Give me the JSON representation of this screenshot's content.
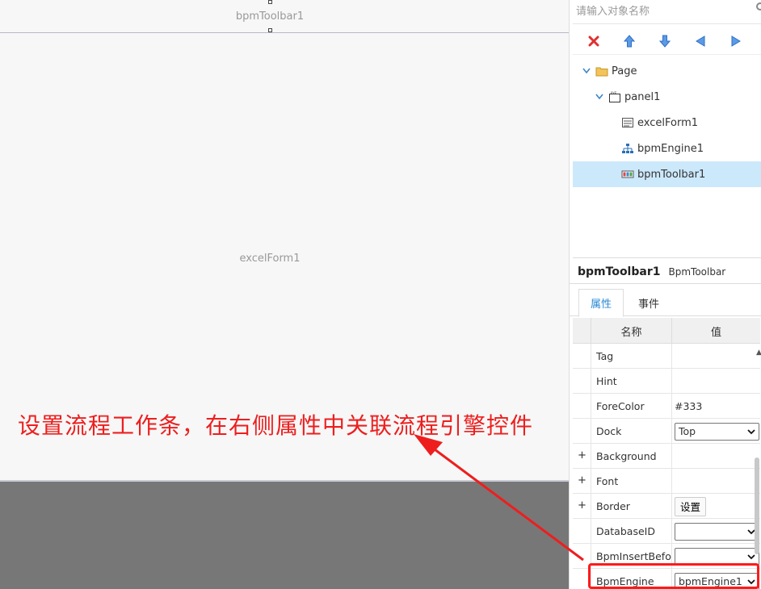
{
  "canvas": {
    "toolbar_control_name": "bpmToolbar1",
    "form_control_name": "excelForm1"
  },
  "annotation": {
    "text": "设置流程工作条，在右侧属性中关联流程引擎控件",
    "color": "#ee1e1e"
  },
  "side": {
    "search_placeholder": "请输入对象名称",
    "tree_toolbar": [
      {
        "icon": "delete-icon",
        "color": "#e03030"
      },
      {
        "icon": "arrow-up-icon",
        "color": "#3a7bd5"
      },
      {
        "icon": "arrow-down-icon",
        "color": "#3a7bd5"
      },
      {
        "icon": "arrow-left-icon",
        "color": "#3a7bd5"
      },
      {
        "icon": "arrow-right-icon",
        "color": "#3a7bd5"
      }
    ],
    "tree": [
      {
        "label": "Page",
        "icon": "folder-icon",
        "expanded": true
      },
      {
        "label": "panel1",
        "icon": "panel-icon",
        "expanded": true
      },
      {
        "label": "excelForm1",
        "icon": "form-icon"
      },
      {
        "label": "bpmEngine1",
        "icon": "engine-icon"
      },
      {
        "label": "bpmToolbar1",
        "icon": "toolbar-icon",
        "selected": true
      }
    ]
  },
  "properties": {
    "object_name": "bpmToolbar1",
    "object_type": "BpmToolbar",
    "tabs": [
      "属性",
      "事件"
    ],
    "active_tab": "属性",
    "headers": {
      "name": "名称",
      "value": "值"
    },
    "rows": [
      {
        "name": "Tag",
        "value": ""
      },
      {
        "name": "Hint",
        "value": ""
      },
      {
        "name": "ForeColor",
        "value": "#333"
      },
      {
        "name": "Dock",
        "value": "Top",
        "kind": "select"
      },
      {
        "name": "Background",
        "value": "",
        "expandable": true
      },
      {
        "name": "Font",
        "value": "",
        "expandable": true
      },
      {
        "name": "Border",
        "value": "设置",
        "kind": "button",
        "expandable": true
      },
      {
        "name": "DatabaseID",
        "value": "",
        "kind": "select"
      },
      {
        "name": "BpmInsertBefo...",
        "value": "",
        "kind": "select"
      },
      {
        "name": "BpmEngine",
        "value": "bpmEngine1",
        "kind": "select",
        "highlighted": true
      }
    ]
  }
}
